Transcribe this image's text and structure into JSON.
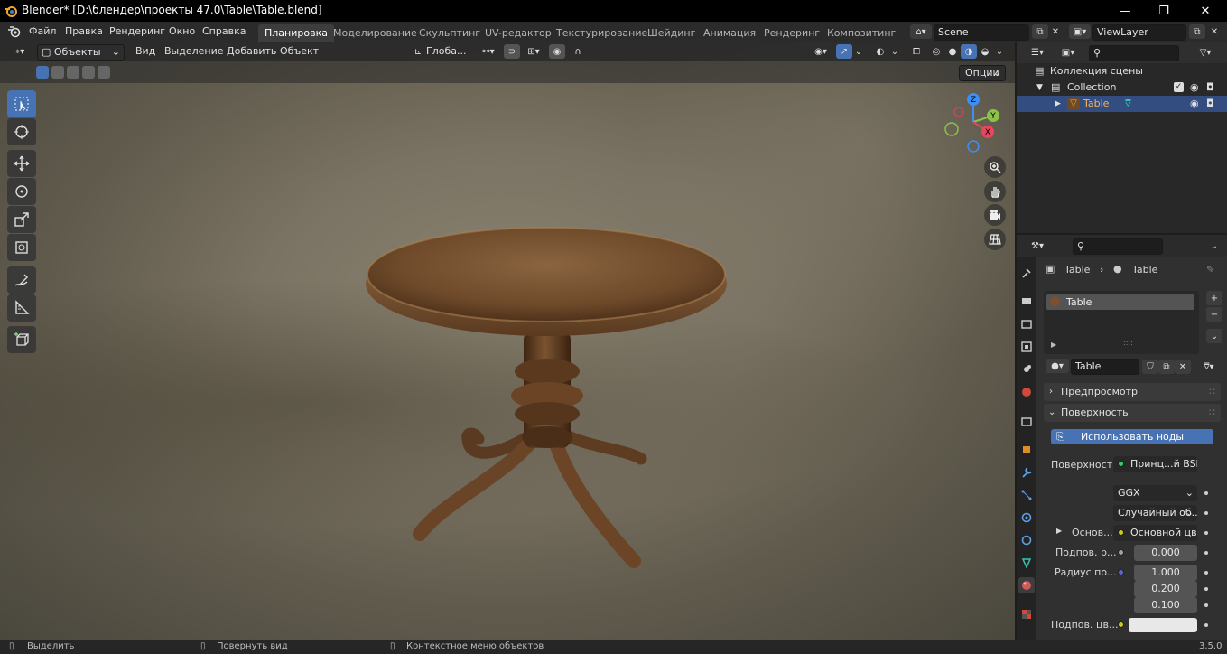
{
  "window": {
    "title": "Blender* [D:\\блендер\\проекты 47.0\\Table\\Table.blend]",
    "minimize_glyph": "—",
    "maximize_glyph": "❐",
    "close_glyph": "✕"
  },
  "topbar": {
    "menus": [
      "Файл",
      "Правка",
      "Рендеринг",
      "Окно",
      "Справка"
    ],
    "workspace_tabs": [
      {
        "label": "Планировка",
        "active": true
      },
      {
        "label": "Моделирование"
      },
      {
        "label": "Скульптинг"
      },
      {
        "label": "UV-редактор"
      },
      {
        "label": "Текстурирование"
      },
      {
        "label": "Шейдинг"
      },
      {
        "label": "Анимация"
      },
      {
        "label": "Рендеринг"
      },
      {
        "label": "Композитинг"
      }
    ],
    "scene_name": "Scene",
    "view_layer": "ViewLayer"
  },
  "viewport": {
    "mode": "Объекты",
    "menus": [
      "Вид",
      "Выделение",
      "Добавить",
      "Объект"
    ],
    "transform_orientation": "Глоба...",
    "options_label": "Опции",
    "gizmo_labels": {
      "z": "Z",
      "y": "Y",
      "x": "X"
    }
  },
  "outliner": {
    "scene_collection": "Коллекция сцены",
    "collection": "Collection",
    "object": "Table",
    "search_placeholder": ""
  },
  "properties": {
    "breadcrumb_object": "Table",
    "breadcrumb_material": "Table",
    "material_slot": "Table",
    "material_name": "Table",
    "panels": {
      "preview": "Предпросмотр",
      "surface": "Поверхность"
    },
    "use_nodes_button": "Использовать ноды",
    "surface_label": "Поверхность",
    "surface_shader": "Принц...й BSDF",
    "distribution": "GGX",
    "subsurface_method": "Случайный об...",
    "base_color_label": "Основ...",
    "base_color_value": "Основной цвет",
    "subsurface_label": "Подпов. р...",
    "subsurface_value": "0.000",
    "radius_label": "Радиус по...",
    "radius_values": [
      "1.000",
      "0.200",
      "0.100"
    ],
    "subsurface_color_label": "Подпов. цв..."
  },
  "statusbar": {
    "select": "Выделить",
    "rotate_view": "Повернуть вид",
    "context_menu": "Контекстное меню объектов",
    "version": "3.5.0"
  },
  "colors": {
    "accent_blue": "#4772b3",
    "selected_row": "#334d80",
    "gizmo_x": "#e8455f",
    "gizmo_y": "#8bc34a",
    "gizmo_z": "#3b8ff5",
    "wood": "#6b4426"
  }
}
